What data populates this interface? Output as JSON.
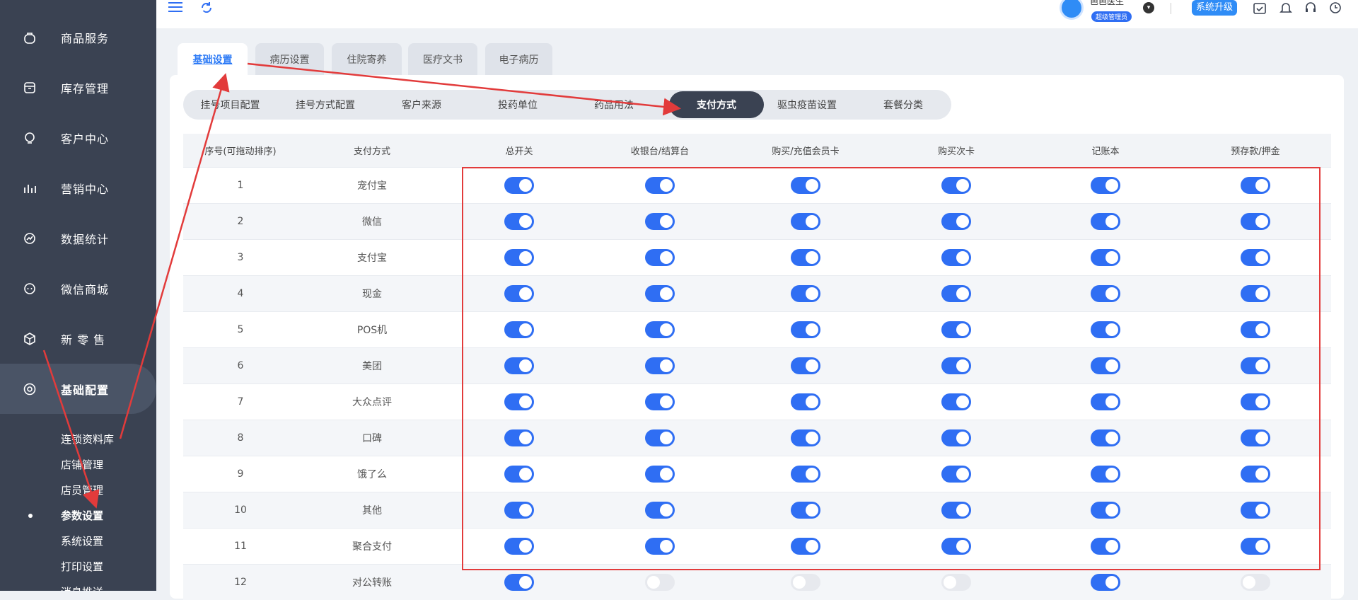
{
  "sidebar": {
    "items": [
      {
        "label": "商品服务",
        "icon": "bag-icon"
      },
      {
        "label": "库存管理",
        "icon": "box-icon"
      },
      {
        "label": "客户中心",
        "icon": "headset-icon"
      },
      {
        "label": "营销中心",
        "icon": "chart-icon"
      },
      {
        "label": "数据统计",
        "icon": "stats-icon"
      },
      {
        "label": "微信商城",
        "icon": "chat-icon"
      },
      {
        "label": "新 零 售",
        "icon": "cube-icon"
      },
      {
        "label": "基础配置",
        "icon": "settings-icon"
      }
    ],
    "sub_items": [
      "连锁资料库",
      "店铺管理",
      "店员管理",
      "参数设置",
      "系统设置",
      "打印设置",
      "消息推送"
    ]
  },
  "topbar": {
    "user_name": "芭芭医生",
    "user_role": "超级管理员",
    "upgrade_label": "系统升级"
  },
  "page_tabs": [
    "基础设置",
    "病历设置",
    "住院寄养",
    "医疗文书",
    "电子病历"
  ],
  "sub_tabs": [
    "挂号项目配置",
    "挂号方式配置",
    "客户来源",
    "投药单位",
    "药品用法",
    "支付方式",
    "驱虫疫苗设置",
    "套餐分类"
  ],
  "table": {
    "headers": [
      "序号(可拖动排序)",
      "支付方式",
      "总开关",
      "收银台/结算台",
      "购买/充值会员卡",
      "购买次卡",
      "记账本",
      "预存款/押金"
    ],
    "rows": [
      {
        "no": "1",
        "method": "宠付宝",
        "toggles": [
          true,
          true,
          true,
          true,
          true,
          true
        ]
      },
      {
        "no": "2",
        "method": "微信",
        "toggles": [
          true,
          true,
          true,
          true,
          true,
          true
        ]
      },
      {
        "no": "3",
        "method": "支付宝",
        "toggles": [
          true,
          true,
          true,
          true,
          true,
          true
        ]
      },
      {
        "no": "4",
        "method": "现金",
        "toggles": [
          true,
          true,
          true,
          true,
          true,
          true
        ]
      },
      {
        "no": "5",
        "method": "POS机",
        "toggles": [
          true,
          true,
          true,
          true,
          true,
          true
        ]
      },
      {
        "no": "6",
        "method": "美团",
        "toggles": [
          true,
          true,
          true,
          true,
          true,
          true
        ]
      },
      {
        "no": "7",
        "method": "大众点评",
        "toggles": [
          true,
          true,
          true,
          true,
          true,
          true
        ]
      },
      {
        "no": "8",
        "method": "口碑",
        "toggles": [
          true,
          true,
          true,
          true,
          true,
          true
        ]
      },
      {
        "no": "9",
        "method": "饿了么",
        "toggles": [
          true,
          true,
          true,
          true,
          true,
          true
        ]
      },
      {
        "no": "10",
        "method": "其他",
        "toggles": [
          true,
          true,
          true,
          true,
          true,
          true
        ]
      },
      {
        "no": "11",
        "method": "聚合支付",
        "toggles": [
          true,
          true,
          true,
          true,
          true,
          true
        ]
      },
      {
        "no": "12",
        "method": "对公转账",
        "toggles": [
          true,
          false,
          false,
          false,
          true,
          false
        ]
      }
    ]
  },
  "colors": {
    "accent": "#2f6ef3",
    "sidebar": "#3a4252",
    "annotation": "#e23b3b"
  }
}
